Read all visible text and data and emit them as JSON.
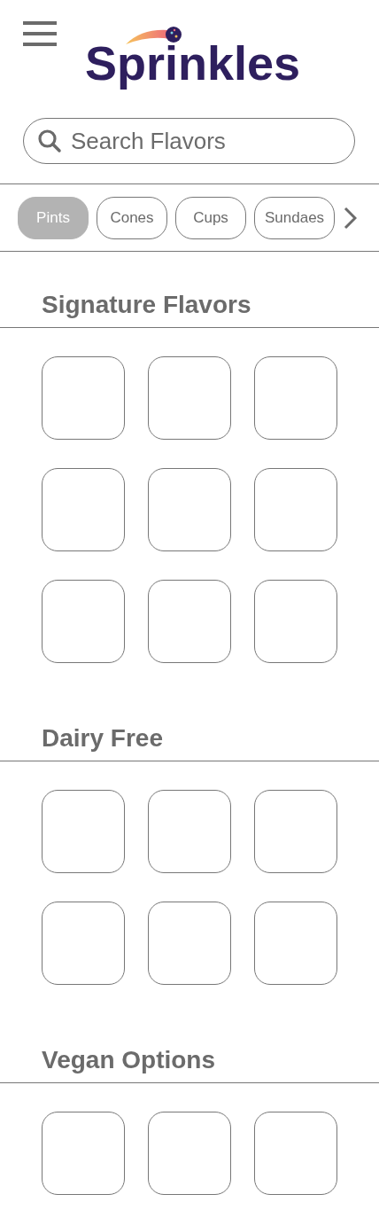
{
  "header": {
    "logo_text": "Sprinkles"
  },
  "search": {
    "placeholder": "Search Flavors"
  },
  "categories": [
    {
      "label": "Pints",
      "selected": true
    },
    {
      "label": "Cones",
      "selected": false
    },
    {
      "label": "Cups",
      "selected": false
    },
    {
      "label": "Sundaes",
      "selected": false
    }
  ],
  "sections": [
    {
      "title": "Signature Flavors",
      "tiles": [
        {
          "kind": "placeholder"
        },
        {
          "kind": "placeholder"
        },
        {
          "kind": "placeholder"
        },
        {
          "kind": "placeholder"
        },
        {
          "kind": "placeholder"
        },
        {
          "kind": "placeholder"
        },
        {
          "kind": "placeholder"
        },
        {
          "kind": "placeholder"
        },
        {
          "kind": "placeholder"
        }
      ]
    },
    {
      "title": "Dairy Free",
      "tiles": [
        {
          "kind": "placeholder"
        },
        {
          "kind": "placeholder"
        },
        {
          "kind": "placeholder"
        },
        {
          "kind": "placeholder"
        },
        {
          "kind": "placeholder"
        },
        {
          "kind": "placeholder"
        }
      ]
    },
    {
      "title": "Vegan Options",
      "tiles": [
        {
          "kind": "placeholder"
        },
        {
          "kind": "placeholder"
        },
        {
          "kind": "placeholder"
        }
      ]
    }
  ]
}
